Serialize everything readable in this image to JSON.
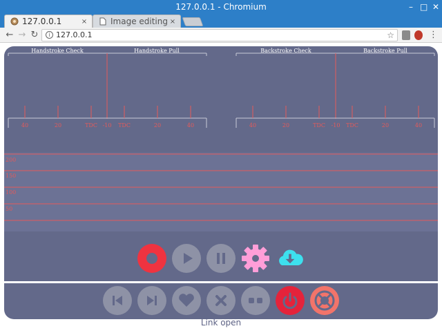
{
  "window": {
    "title": "127.0.0.1 - Chromium"
  },
  "tabs": [
    {
      "label": "127.0.0.1",
      "close": "×"
    },
    {
      "label": "Image editing on y",
      "close": "×"
    }
  ],
  "toolbar": {
    "url": "127.0.0.1"
  },
  "scale": {
    "left": {
      "check_label": "Handstroke Check",
      "pull_label": "Handstroke Pull",
      "ticks": [
        "40",
        "20",
        "TDC",
        "-10",
        "TDC",
        "20",
        "40"
      ]
    },
    "right": {
      "check_label": "Backstroke Check",
      "pull_label": "Backstroke Pull",
      "ticks": [
        "40",
        "20",
        "TDC",
        "-10",
        "TDC",
        "20",
        "40"
      ]
    }
  },
  "grid": {
    "labels": [
      "200",
      "150",
      "100",
      "50"
    ]
  },
  "controls": {
    "row1": [
      {
        "name": "record-button",
        "icon": "record-icon"
      },
      {
        "name": "play-button",
        "icon": "play-icon"
      },
      {
        "name": "pause-button",
        "icon": "pause-icon"
      },
      {
        "name": "settings-button",
        "icon": "gear-icon"
      },
      {
        "name": "download-button",
        "icon": "cloud-download-icon"
      }
    ],
    "row2": [
      {
        "name": "skip-back-button",
        "icon": "skip-back-icon"
      },
      {
        "name": "skip-forward-button",
        "icon": "skip-forward-icon"
      },
      {
        "name": "favorite-button",
        "icon": "heart-icon"
      },
      {
        "name": "close-button",
        "icon": "x-icon"
      },
      {
        "name": "link-button",
        "icon": "link-icon"
      },
      {
        "name": "power-button",
        "icon": "power-icon"
      },
      {
        "name": "help-button",
        "icon": "lifebuoy-icon"
      }
    ]
  },
  "colors": {
    "panel": "#63698a",
    "accent_red": "#ef3340",
    "tick_red": "#e45a5a",
    "pink": "#ff9ed8",
    "cyan": "#3de0ee",
    "power_red": "#e4233b",
    "lifebuoy": "#f2746a",
    "button_gray": "#8e92a6"
  },
  "status": {
    "text": "Link open"
  }
}
